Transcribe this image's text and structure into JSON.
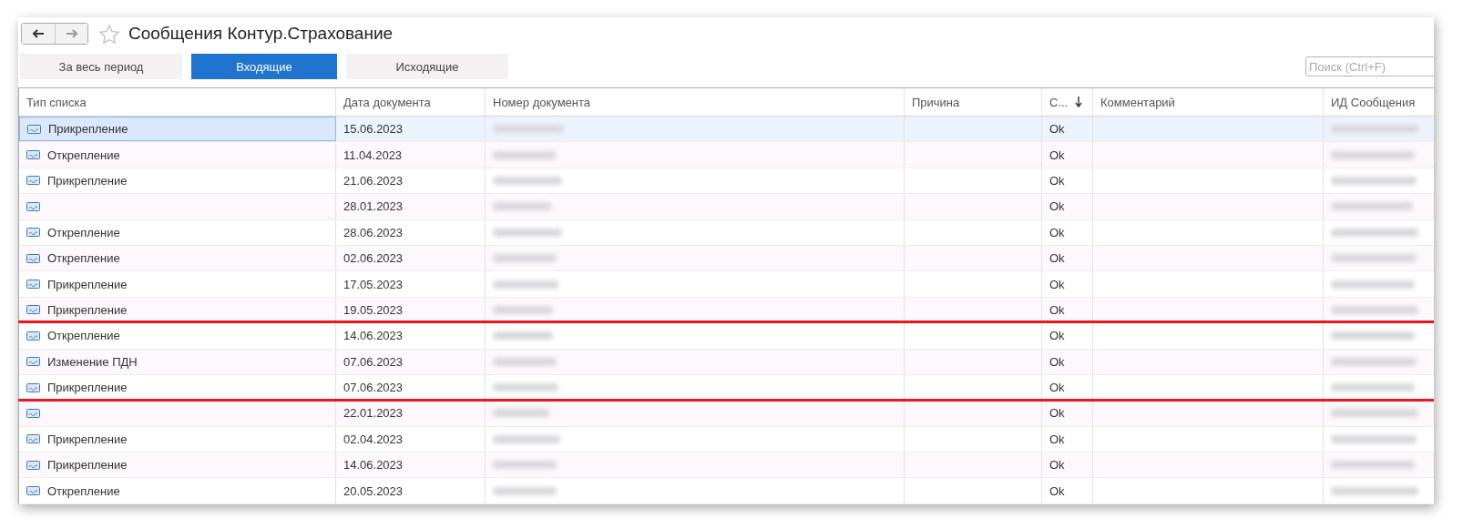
{
  "window": {
    "title": "Сообщения Контур.Страхование"
  },
  "tabs": [
    {
      "label": "За весь период",
      "selected": false
    },
    {
      "label": "Входящие",
      "selected": true
    },
    {
      "label": "Исходящие",
      "selected": false
    }
  ],
  "search": {
    "placeholder": "Поиск (Ctrl+F)"
  },
  "table": {
    "columns": [
      "Тип списка",
      "Дата документа",
      "Номер документа",
      "Причина",
      "С...",
      "Комментарий",
      "ИД Сообщения"
    ],
    "rows": [
      {
        "type": "Прикрепление",
        "date": "15.06.2023",
        "status": "Ok",
        "selected": true,
        "highlighted": false
      },
      {
        "type": "Открепление",
        "date": "11.04.2023",
        "status": "Ok",
        "selected": false,
        "highlighted": false
      },
      {
        "type": "Прикрепление",
        "date": "21.06.2023",
        "status": "Ok",
        "selected": false,
        "highlighted": false
      },
      {
        "date": "28.01.2023",
        "status": "Ok",
        "selected": false,
        "highlighted": false
      },
      {
        "type": "Открепление",
        "date": "28.06.2023",
        "status": "Ok",
        "selected": false,
        "highlighted": false
      },
      {
        "type": "Открепление",
        "date": "02.06.2023",
        "status": "Ok",
        "selected": false,
        "highlighted": false
      },
      {
        "type": "Прикрепление",
        "date": "17.05.2023",
        "status": "Ok",
        "selected": false,
        "highlighted": false
      },
      {
        "type": "Прикрепление",
        "date": "19.05.2023",
        "status": "Ok",
        "selected": false,
        "highlighted": false
      },
      {
        "type": "Открепление",
        "date": "14.06.2023",
        "status": "Ok",
        "selected": false,
        "highlighted": true
      },
      {
        "type": "Изменение ПДН",
        "date": "07.06.2023",
        "status": "Ok",
        "selected": false,
        "highlighted": true
      },
      {
        "type": "Прикрепление",
        "date": "07.06.2023",
        "status": "Ok",
        "selected": false,
        "highlighted": true
      },
      {
        "date": "22.01.2023",
        "status": "Ok",
        "selected": false,
        "highlighted": false
      },
      {
        "type": "Прикрепление",
        "date": "02.04.2023",
        "status": "Ok",
        "selected": false,
        "highlighted": false
      },
      {
        "type": "Прикрепление",
        "date": "14.06.2023",
        "status": "Ok",
        "selected": false,
        "highlighted": false
      },
      {
        "type": "Открепление",
        "date": "20.05.2023",
        "status": "Ok",
        "selected": false,
        "highlighted": false
      }
    ]
  }
}
